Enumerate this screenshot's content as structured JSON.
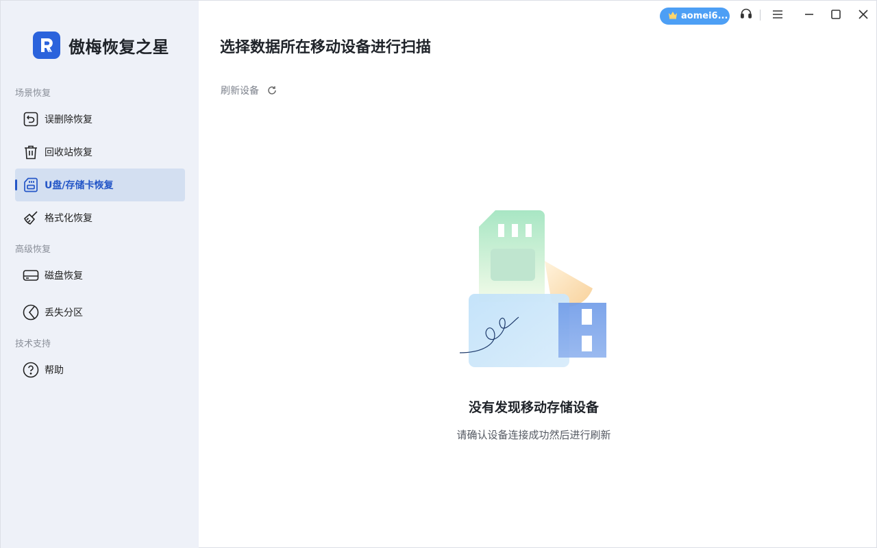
{
  "app": {
    "name": "傲梅恢复之星",
    "accent": "#2b63dc"
  },
  "titlebar": {
    "user": "aomei6...",
    "user_icon": "crown-icon",
    "buttons": [
      "headset-icon",
      "menu-icon",
      "minimize-icon",
      "maximize-icon",
      "close-icon"
    ]
  },
  "sidebar": {
    "sections": [
      {
        "label": "场景恢复",
        "items": [
          {
            "label": "误删除恢复",
            "icon": "undo-file-icon"
          },
          {
            "label": "回收站恢复",
            "icon": "trash-icon"
          },
          {
            "label": "U盘/存储卡恢复",
            "icon": "sd-card-icon",
            "active": true
          },
          {
            "label": "格式化恢复",
            "icon": "broom-icon"
          }
        ]
      },
      {
        "label": "高级恢复",
        "items": [
          {
            "label": "磁盘恢复",
            "icon": "disk-icon"
          },
          {
            "label": "丢失分区",
            "icon": "partition-icon"
          }
        ]
      },
      {
        "label": "技术支持",
        "items": [
          {
            "label": "帮助",
            "icon": "help-icon"
          }
        ]
      }
    ]
  },
  "main": {
    "title": "选择数据所在移动设备进行扫描",
    "refresh_label": "刷新设备",
    "empty": {
      "title": "没有发现移动存储设备",
      "subtitle": "请确认设备连接成功然后进行刷新",
      "illustration": "sd-card-and-usb-illustration"
    }
  }
}
